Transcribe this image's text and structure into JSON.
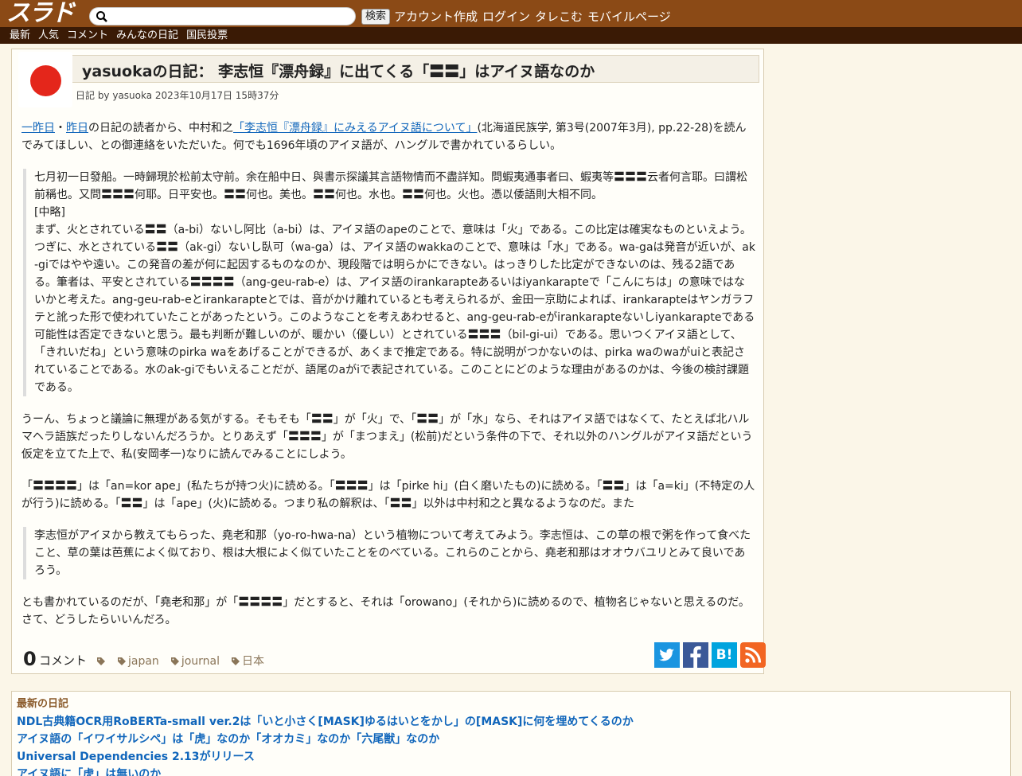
{
  "header": {
    "logo": "スラド",
    "search": {
      "value": "",
      "placeholder": ""
    },
    "search_button": "検索",
    "links": [
      "アカウント作成",
      "ログイン",
      "タレこむ",
      "モバイルページ"
    ]
  },
  "subnav": [
    "最新",
    "人気",
    "コメント",
    "みんなの日記",
    "国民投票"
  ],
  "article": {
    "title": "yasuokaの日記： 李志恒『漂舟録』に出てくる「〓〓」はアイヌ語なのか",
    "byline": "日記 by yasuoka 2023年10月17日 15時37分",
    "p1": {
      "link1": "一昨日",
      "sep": "・",
      "link2": "昨日",
      "text1": "の日記の読者から、中村和之",
      "link3": "「李志恒『漂舟録』にみえるアイヌ語について」",
      "text2": "(北海道民族学, 第3号(2007年3月), pp.22-28)を読んでみてほしい、との御連絡をいただいた。何でも1696年頃のアイヌ語が、ハングルで書かれているらしい。"
    },
    "quote1": {
      "line1": "七月初一日發船。一時歸現於松前太守前。余在船中日、與書示探議其言語物情而不盡詳知。問蝦夷通事者曰、蝦夷等〓〓〓云者何言耶。曰謂松前稱也。又問〓〓〓何耶。日平安也。〓〓何也。美也。〓〓何也。水也。〓〓何也。火也。憑以倭語則大相不同。",
      "line2": "[中略]",
      "line3": "まず、火とされている〓〓（a-bi）ないし阿比（a-bi）は、アイヌ語のapeのことで、意味は「火」である。この比定は確実なものといえよう。つぎに、水とされている〓〓（ak-gi）ないし臥可（wa-ga）は、アイヌ語のwakkaのことで、意味は「水」である。wa-gaは発音が近いが、ak-giではやや遠い。この発音の差が何に起因するものなのか、現段階では明らかにできない。はっきりした比定ができないのは、残る2語である。筆者は、平安とされている〓〓〓〓（ang-geu-rab-e）は、アイヌ語のirankarapteあるいはiyankarapteで「こんにちは」の意味ではないかと考えた。ang-geu-rab-eとirankarapteとでは、音がかけ離れているとも考えられるが、金田一京助によれば、irankarapteはヤンガラフテと訛った形で使われていたことがあったという。このようなことを考えあわせると、ang-geu-rab-eがirankarapteないしiyankarapteである可能性は否定できないと思う。最も判断が難しいのが、暖かい（優しい）とされている〓〓〓（bil-gi-ui）である。思いつくアイヌ語として、「きれいだね」という意味のpirka waをあげることができるが、あくまで推定である。特に説明がつかないのは、pirka waのwaがuiと表記されていることである。水のak-giでもいえることだが、語尾のaがiで表記されている。このことにどのような理由があるのかは、今後の検討課題である。"
    },
    "p2": "うーん、ちょっと議論に無理がある気がする。そもそも「〓〓」が「火」で、「〓〓」が「水」なら、それはアイヌ語ではなくて、たとえば北ハルマヘラ語族だったりしないんだろうか。とりあえず「〓〓〓」が「まつまえ」(松前)だという条件の下で、それ以外のハングルがアイヌ語だという仮定を立てた上で、私(安岡孝一)なりに読んでみることにしよう。",
    "p3": "「〓〓〓〓」は「an=kor ape」(私たちが持つ火)に読める。「〓〓〓」は「pirke hi」(白く磨いたもの)に読める。「〓〓」は「a=ki」(不特定の人が行う)に読める。「〓〓」は「ape」(火)に読める。つまり私の解釈は、「〓〓」以外は中村和之と異なるようなのだ。また",
    "quote2": "李志恒がアイヌから教えてもらった、堯老和那（yo-ro-hwa-na）という植物について考えてみよう。李志恒は、この草の根で粥を作って食べたこと、草の葉は芭蕉によく似ており、根は大根によく似ていたことをのべている。これらのことから、堯老和那はオオウバユリとみて良いであろう。",
    "p4": "とも書かれているのだが、「堯老和那」が「〓〓〓〓」だとすると、それは「orowano」(それから)に読めるので、植物名じゃないと思えるのだ。さて、どうしたらいいんだろ。",
    "comment_count": "0",
    "comment_label": "コメント",
    "tags": [
      "japan",
      "journal",
      "日本"
    ],
    "share": {
      "twitter": "twitter-icon",
      "facebook": "facebook-icon",
      "hatena": "B!",
      "rss": "rss-icon"
    }
  },
  "recent": {
    "heading": "最新の日記",
    "items": [
      "NDL古典籍OCR用RoBERTa-small ver.2は「いと小さく[MASK]ゆるはいとをかし」の[MASK]に何を埋めてくるのか",
      "アイヌ語の「イワイサルシペ」は「虎」なのか「オオカミ」なのか「六尾獣」なのか",
      "Universal Dependencies 2.13がリリース",
      "アイヌ語に「虎」は無いのか"
    ]
  }
}
